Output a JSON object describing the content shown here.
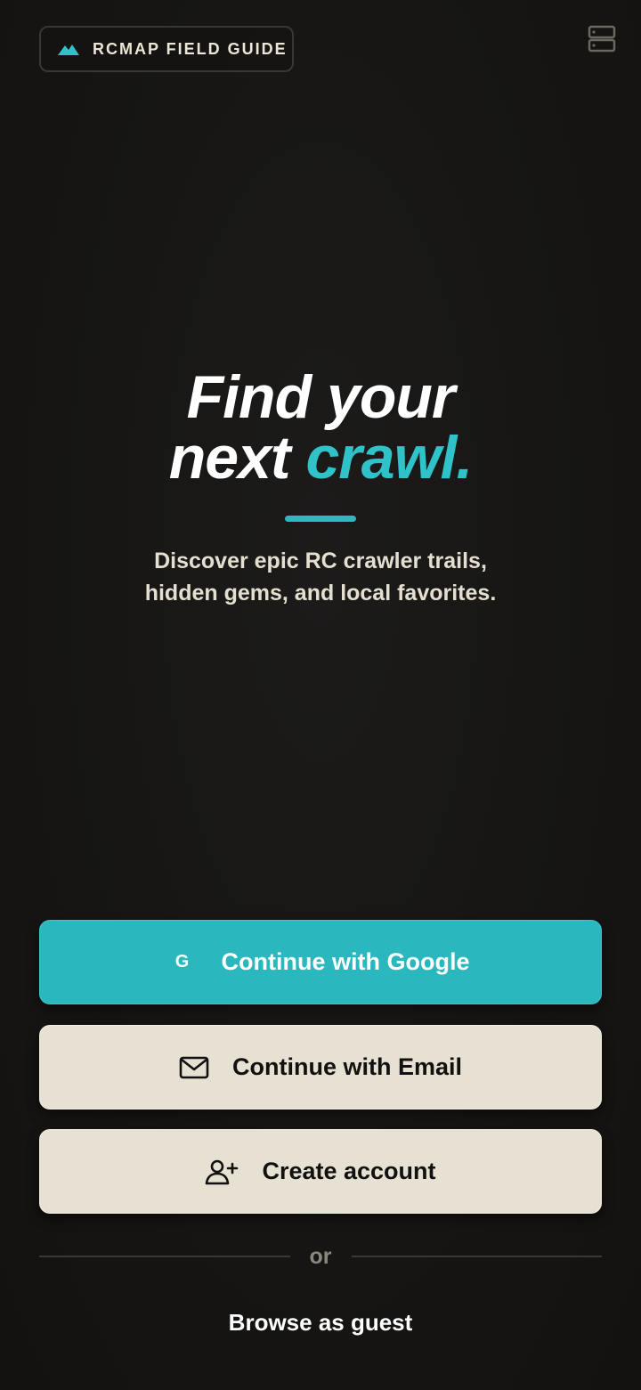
{
  "brand": {
    "label": "RCMAP FIELD GUIDE",
    "icon": "mountain-icon"
  },
  "menu": {
    "icon": "server-stack-icon"
  },
  "hero": {
    "headline_line1": "Find your",
    "headline_line2_prefix": "next ",
    "headline_line2_accent": "crawl.",
    "subtitle_line1": "Discover epic RC crawler trails,",
    "subtitle_line2": "hidden gems, and local favorites."
  },
  "actions": {
    "google": {
      "glyph": "G",
      "label": "Continue with Google"
    },
    "email": {
      "icon": "mail-icon",
      "label": "Continue with Email"
    },
    "create": {
      "icon": "user-plus-icon",
      "label": "Create account"
    }
  },
  "divider": {
    "label": "or"
  },
  "guest": {
    "label": "Browse as guest"
  },
  "colors": {
    "accent": "#2fc2c9",
    "background": "#171513",
    "button_light": "#e6e1d3",
    "text_light": "#ece6d8"
  }
}
